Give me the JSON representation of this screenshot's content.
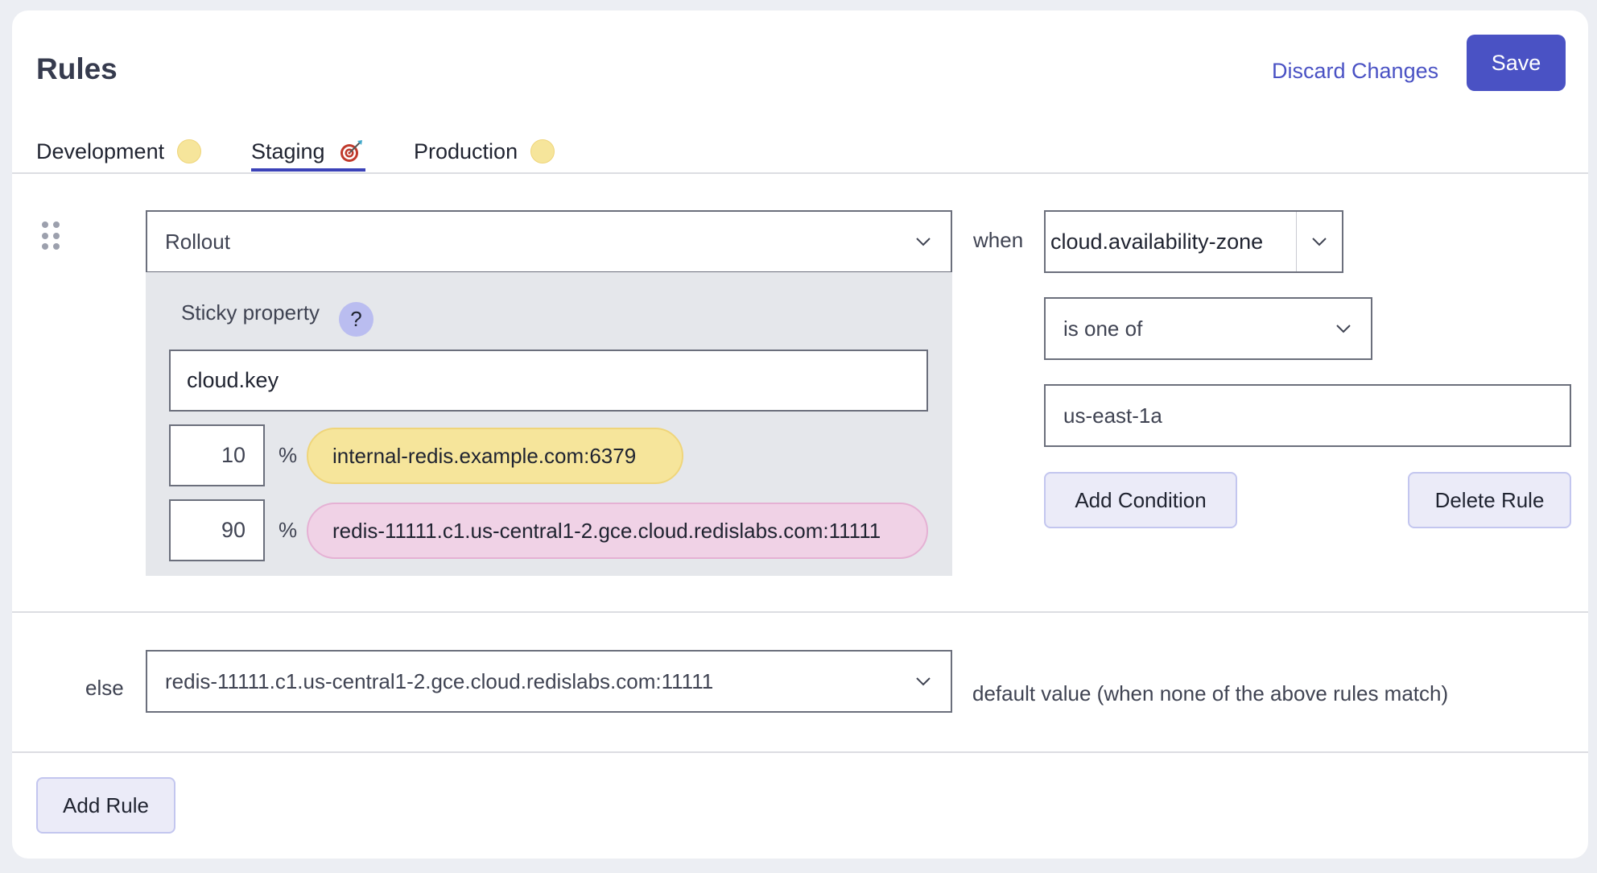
{
  "header": {
    "title": "Rules",
    "discard_label": "Discard Changes",
    "save_label": "Save"
  },
  "tabs": [
    {
      "label": "Development",
      "icon": "status-dot-icon",
      "active": false
    },
    {
      "label": "Staging",
      "icon": "target-dart-icon",
      "active": true
    },
    {
      "label": "Production",
      "icon": "status-dot-icon",
      "active": false
    }
  ],
  "rule": {
    "type_select": "Rollout",
    "sticky_label": "Sticky property",
    "help_icon": "?",
    "sticky_value": "cloud.key",
    "splits": [
      {
        "percent": "10",
        "percent_symbol": "%",
        "value": "internal-redis.example.com:6379",
        "color": "#f6e59b"
      },
      {
        "percent": "90",
        "percent_symbol": "%",
        "value": "redis-11111.c1.us-central1-2.gce.cloud.redislabs.com:11111",
        "color": "#f0d2e6"
      }
    ],
    "when_label": "when",
    "condition": {
      "property": "cloud.availability-zone",
      "operator": "is one of",
      "value": "us-east-1a"
    },
    "add_condition_label": "Add Condition",
    "delete_rule_label": "Delete Rule"
  },
  "else_row": {
    "label": "else",
    "value": "redis-11111.c1.us-central1-2.gce.cloud.redislabs.com:11111",
    "hint": "default value (when none of the above rules match)"
  },
  "footer": {
    "add_rule_label": "Add Rule"
  },
  "colors": {
    "accent": "#4a52c4",
    "tab_underline": "#3b42b8",
    "panel_bg": "#e5e7eb"
  }
}
